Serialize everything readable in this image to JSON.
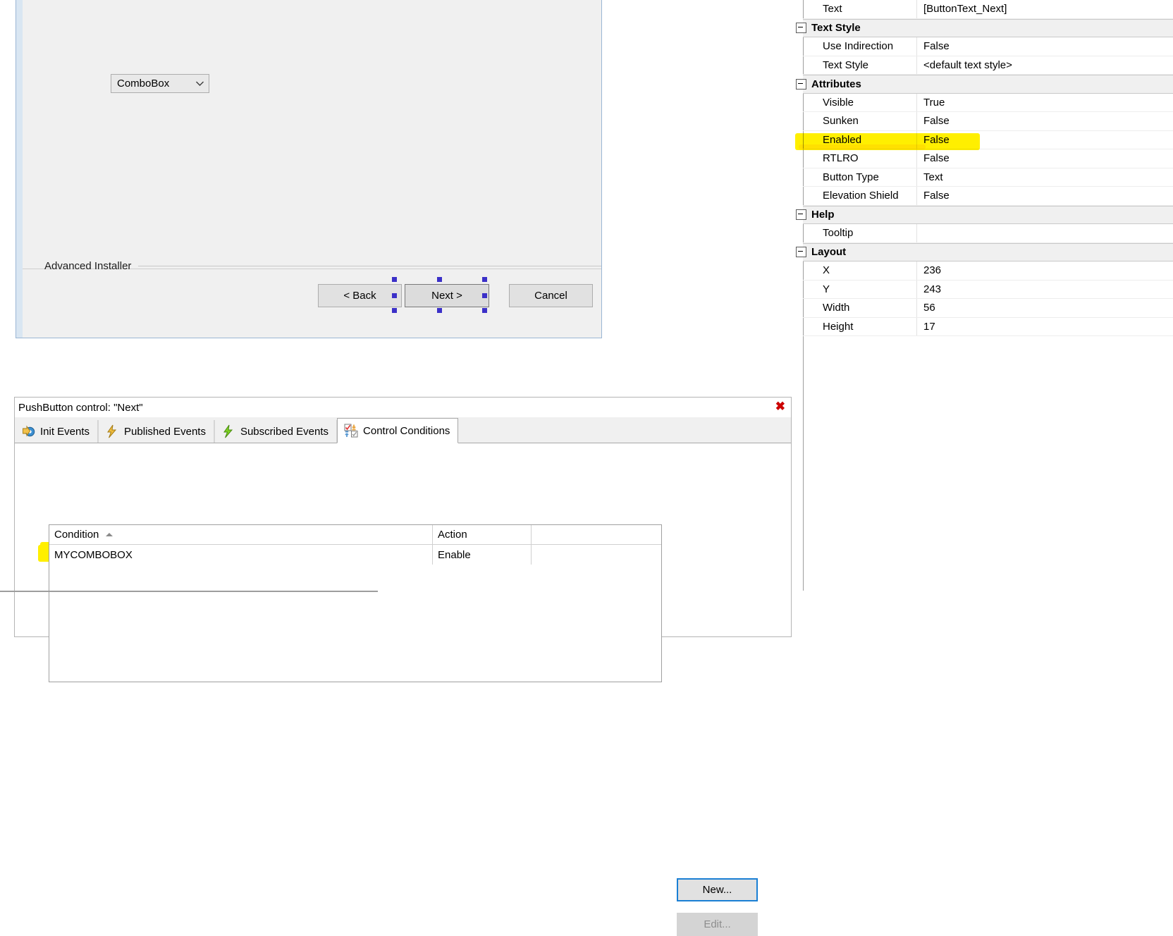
{
  "designer": {
    "dialog": {
      "combobox": {
        "value": "ComboBox",
        "arrow": "chevron-down-icon"
      },
      "brand_label": "Advanced Installer",
      "buttons": {
        "back": "< Back",
        "next": "Next >",
        "cancel": "Cancel"
      }
    }
  },
  "bottom_panel": {
    "title": "PushButton control: \"Next\"",
    "close_label": "✖",
    "tabs": [
      {
        "label": "Init Events",
        "icon": "init-events-icon",
        "active": false
      },
      {
        "label": "Published Events",
        "icon": "published-events-icon",
        "active": false
      },
      {
        "label": "Subscribed Events",
        "icon": "subscribed-events-icon",
        "active": false
      },
      {
        "label": "Control Conditions",
        "icon": "control-conditions-icon",
        "active": true
      }
    ],
    "conditions_table": {
      "columns": [
        "Condition",
        "Action",
        ""
      ],
      "sort_column": "Condition",
      "sort_direction": "ascending",
      "rows": [
        {
          "condition": "MYCOMBOBOX",
          "action": "Enable",
          "highlighted": true
        }
      ]
    },
    "buttons": {
      "new": "New...",
      "edit": "Edit..."
    }
  },
  "property_grid": {
    "rows": [
      {
        "kind": "prop",
        "name": "Text",
        "value": "[ButtonText_Next]"
      },
      {
        "kind": "category",
        "name": "Text Style"
      },
      {
        "kind": "prop",
        "name": "Use Indirection",
        "value": "False"
      },
      {
        "kind": "prop",
        "name": "Text Style",
        "value": "<default text style>"
      },
      {
        "kind": "category",
        "name": "Attributes"
      },
      {
        "kind": "prop",
        "name": "Visible",
        "value": "True"
      },
      {
        "kind": "prop",
        "name": "Sunken",
        "value": "False"
      },
      {
        "kind": "prop",
        "name": "Enabled",
        "value": "False",
        "highlighted": true
      },
      {
        "kind": "prop",
        "name": "RTLRO",
        "value": "False"
      },
      {
        "kind": "prop",
        "name": "Button Type",
        "value": "Text"
      },
      {
        "kind": "prop",
        "name": "Elevation Shield",
        "value": "False"
      },
      {
        "kind": "category",
        "name": "Help"
      },
      {
        "kind": "prop",
        "name": "Tooltip",
        "value": ""
      },
      {
        "kind": "category",
        "name": "Layout"
      },
      {
        "kind": "prop",
        "name": "X",
        "value": "236"
      },
      {
        "kind": "prop",
        "name": "Y",
        "value": "243"
      },
      {
        "kind": "prop",
        "name": "Width",
        "value": "56"
      },
      {
        "kind": "prop",
        "name": "Height",
        "value": "17"
      }
    ]
  },
  "colors": {
    "highlight": "#ffef00",
    "accent_blue": "#1a7fd4",
    "close_red": "#cc0000",
    "handle_purple": "#3b30c8",
    "panel_bg": "#f0f0f0"
  }
}
